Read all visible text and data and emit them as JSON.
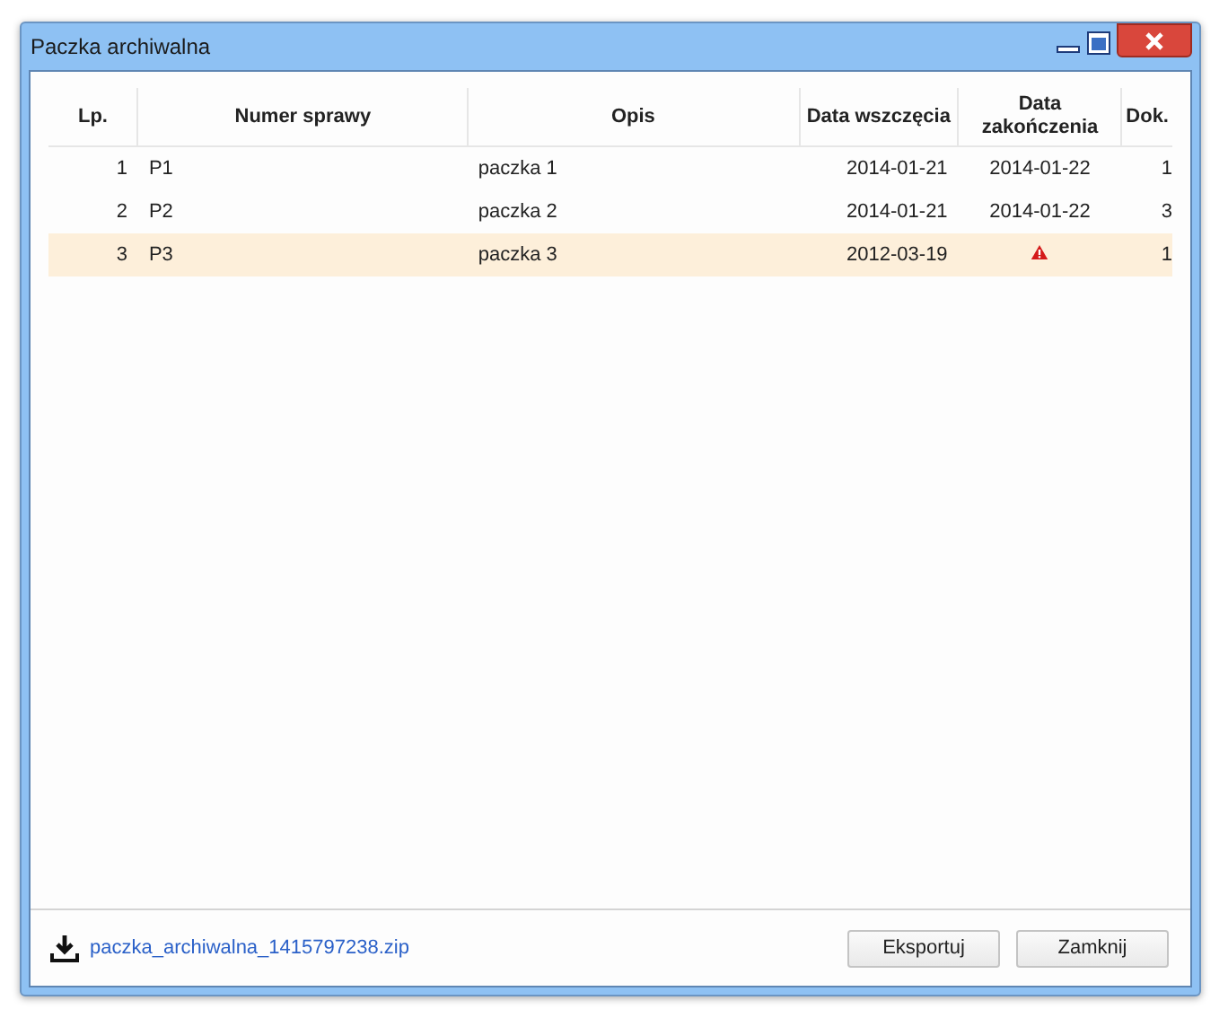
{
  "window": {
    "title": "Paczka archiwalna"
  },
  "table": {
    "columns": [
      {
        "label": "Lp."
      },
      {
        "label": "Numer sprawy"
      },
      {
        "label": "Opis"
      },
      {
        "label": "Data wszczęcia"
      },
      {
        "label": "Data zakończenia"
      },
      {
        "label": "Dok."
      }
    ],
    "rows": [
      {
        "lp": "1",
        "number": "P1",
        "description": "paczka 1",
        "start": "2014-01-21",
        "end": "2014-01-22",
        "warning": false,
        "docs": "1",
        "selected": false
      },
      {
        "lp": "2",
        "number": "P2",
        "description": "paczka 2",
        "start": "2014-01-21",
        "end": "2014-01-22",
        "warning": false,
        "docs": "3",
        "selected": false
      },
      {
        "lp": "3",
        "number": "P3",
        "description": "paczka 3",
        "start": "2012-03-19",
        "warning": true,
        "docs": "1",
        "selected": true
      }
    ]
  },
  "footer": {
    "download_link": "paczka_archiwalna_1415797238.zip",
    "buttons": [
      "Eksportuj",
      "Zamknij"
    ]
  }
}
